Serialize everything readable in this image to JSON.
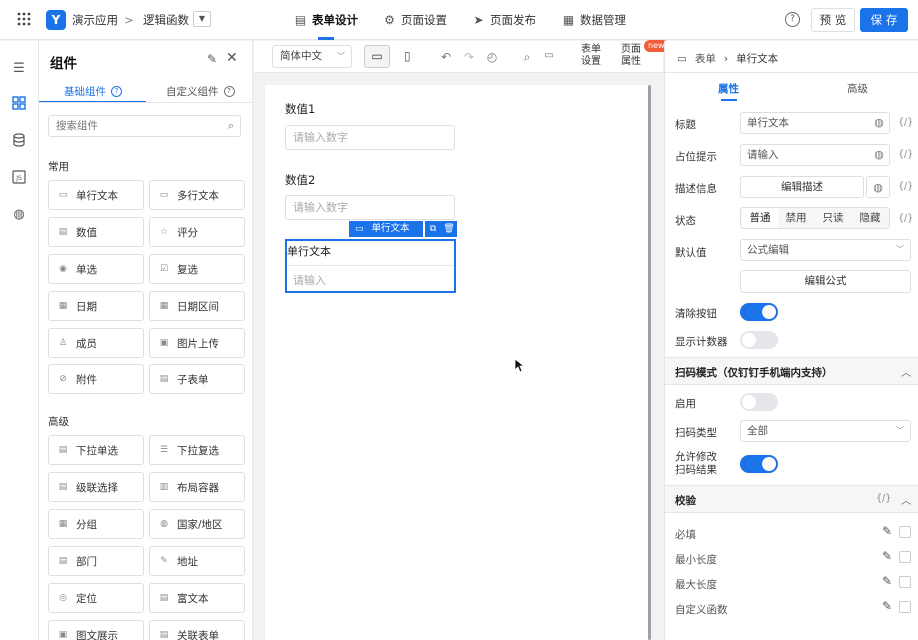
{
  "header": {
    "app_name": "演示应用",
    "breadcrumb_sep": ">",
    "form_name": "逻辑函数",
    "tabs": [
      {
        "label": "表单设计",
        "active": true
      },
      {
        "label": "页面设置",
        "active": false
      },
      {
        "label": "页面发布",
        "active": false
      },
      {
        "label": "数据管理",
        "active": false
      }
    ],
    "help": "?",
    "preview_label": "预 览",
    "save_label": "保 存"
  },
  "left_panel": {
    "title": "组件",
    "tabs": {
      "basic": "基础组件",
      "custom": "自定义组件"
    },
    "search_placeholder": "搜索组件",
    "section_common": "常用",
    "section_advanced": "高级",
    "common": [
      "单行文本",
      "多行文本",
      "数值",
      "评分",
      "单选",
      "复选",
      "日期",
      "日期区间",
      "成员",
      "图片上传",
      "附件",
      "子表单"
    ],
    "advanced": [
      "下拉单选",
      "下拉复选",
      "级联选择",
      "布局容器",
      "分组",
      "国家/地区",
      "部门",
      "地址",
      "定位",
      "富文本",
      "图文展示",
      "关联表单"
    ]
  },
  "toolbar": {
    "language": "简体中文",
    "form_settings": "表单\n设置",
    "page_props": "页面\n属性",
    "new_badge": "new"
  },
  "canvas": {
    "field1_label": "数值1",
    "field1_placeholder": "请输入数字",
    "field2_label": "数值2",
    "field2_placeholder": "请输入数字",
    "selected_tag": "单行文本",
    "selected_label": "单行文本",
    "selected_placeholder": "请输入"
  },
  "right_panel": {
    "breadcrumb_root": "表单",
    "breadcrumb_current": "单行文本",
    "tabs": {
      "props": "属性",
      "advanced": "高级"
    },
    "title_label": "标题",
    "title_value": "单行文本",
    "placeholder_label": "占位提示",
    "placeholder_value": "请输入",
    "desc_label": "描述信息",
    "desc_button": "编辑描述",
    "state_label": "状态",
    "states": [
      "普通",
      "禁用",
      "只读",
      "隐藏"
    ],
    "default_label": "默认值",
    "default_value": "公式编辑",
    "formula_button": "编辑公式",
    "clear_label": "清除按钮",
    "counter_label": "显示计数器",
    "scan_section": "扫码模式（仅钉钉手机端内支持）",
    "enable_label": "启用",
    "scan_type_label": "扫码类型",
    "scan_type_value": "全部",
    "allow_edit_label_1": "允许修改",
    "allow_edit_label_2": "扫码结果",
    "validate_section": "校验",
    "required_label": "必填",
    "min_len_label": "最小长度",
    "max_len_label": "最大长度",
    "custom_fn_label": "自定义函数",
    "brace": "{/}"
  },
  "colors": {
    "accent": "#1a73e8"
  }
}
